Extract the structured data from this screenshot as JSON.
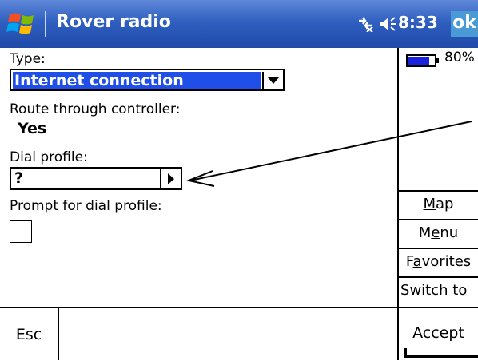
{
  "titlebar": {
    "title": "Rover radio",
    "clock": "8:33",
    "ok_label": "ok",
    "icons": [
      "windows-start-icon",
      "connectivity-icon",
      "volume-icon"
    ]
  },
  "form": {
    "type_label": "Type:",
    "type_value": "Internet connection",
    "route_label": "Route through controller:",
    "route_value": "Yes",
    "dial_label": "Dial profile:",
    "dial_value": "?",
    "prompt_label": "Prompt for dial profile:",
    "prompt_checked": false
  },
  "status": {
    "battery_percent": "80%",
    "battery_level": 0.8
  },
  "side_menu": {
    "map": {
      "pre": "",
      "u": "M",
      "post": "ap"
    },
    "menu": {
      "pre": "M",
      "u": "e",
      "post": "nu"
    },
    "favorites": {
      "pre": "F",
      "u": "a",
      "post": "vorites"
    },
    "switch_to": {
      "pre": "S",
      "u": "w",
      "post": "itch to"
    }
  },
  "bottom": {
    "esc_label": "Esc",
    "accept_label": "Accept"
  },
  "colors": {
    "title_bar": "#2f5fc0",
    "selection": "#1f4fe8",
    "ok_button": "#4a9ad6",
    "battery": "#1a22e0"
  }
}
